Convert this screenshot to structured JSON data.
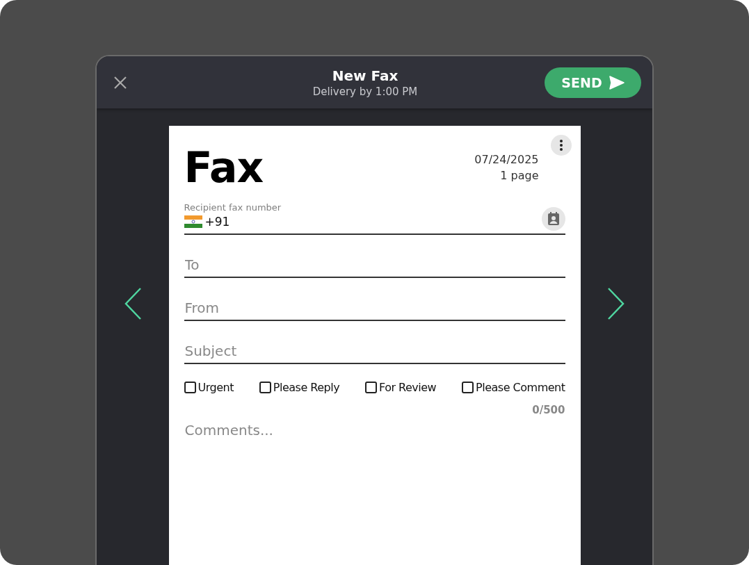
{
  "header": {
    "title": "New Fax",
    "subtitle": "Delivery by 1:00 PM",
    "send_label": "SEND"
  },
  "document": {
    "title": "Fax",
    "date": "07/24/2025",
    "pages": "1 page",
    "recipient": {
      "label": "Recipient fax number",
      "code": "+91"
    },
    "fields": [
      {
        "placeholder": "To"
      },
      {
        "placeholder": "From"
      },
      {
        "placeholder": "Subject"
      }
    ],
    "options": [
      {
        "label": "Urgent",
        "checked": false
      },
      {
        "label": "Please Reply",
        "checked": false
      },
      {
        "label": "For Review",
        "checked": false
      },
      {
        "label": "Please Comment",
        "checked": false
      }
    ],
    "counter": "0/500",
    "comments": {
      "placeholder": "Comments..."
    }
  }
}
